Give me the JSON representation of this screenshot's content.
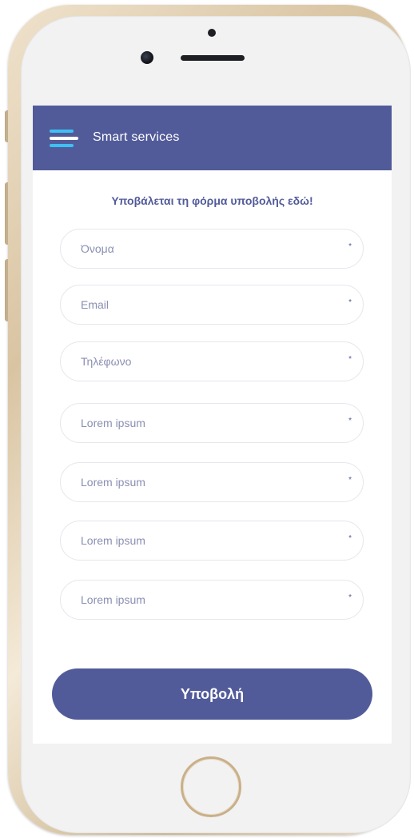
{
  "app": {
    "title": "Smart services",
    "menu_icon": "hamburger-menu-icon"
  },
  "colors": {
    "primary": "#525b99",
    "accent": "#3ec0f2",
    "screen_bg": "#ffffff",
    "field_border": "#e6e6ee"
  },
  "form": {
    "heading": "Υποβάλεται τη φόρμα υποβολής εδώ!",
    "required_mark": "*",
    "fields": [
      {
        "placeholder": "Όνομα",
        "value": ""
      },
      {
        "placeholder": "Email",
        "value": ""
      },
      {
        "placeholder": "Τηλέφωνο",
        "value": ""
      },
      {
        "placeholder": "Lorem ipsum",
        "value": ""
      },
      {
        "placeholder": "Lorem ipsum",
        "value": ""
      },
      {
        "placeholder": "Lorem ipsum",
        "value": ""
      },
      {
        "placeholder": "Lorem ipsum",
        "value": ""
      }
    ],
    "submit_label": "Υποβολή"
  }
}
